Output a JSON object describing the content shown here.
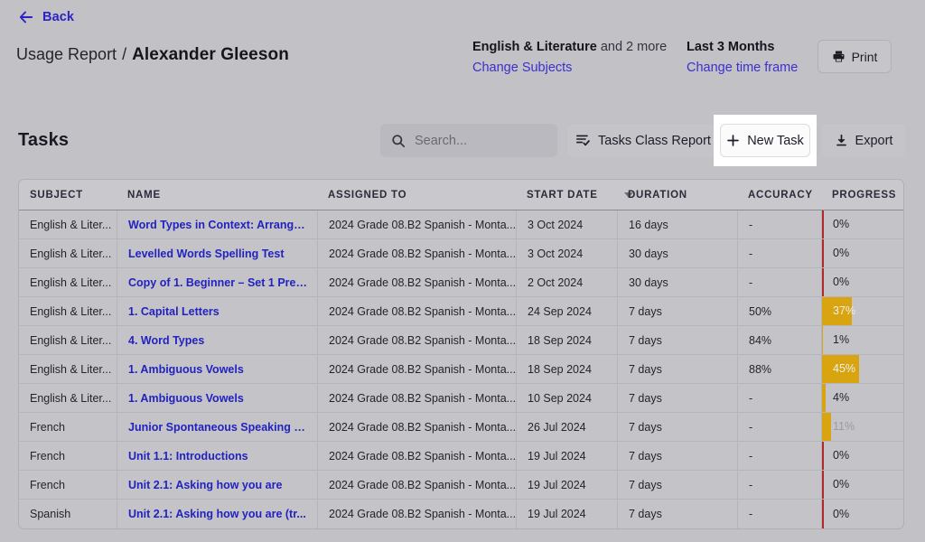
{
  "nav": {
    "back_label": "Back",
    "back_icon": "arrow-left-icon"
  },
  "breadcrumb": {
    "parent": "Usage Report",
    "separator": "/",
    "current": "Alexander Gleeson"
  },
  "header": {
    "subjects": {
      "primary": "English & Literature",
      "suffix": "and 2 more",
      "change_link": "Change Subjects"
    },
    "timeframe": {
      "value": "Last 3 Months",
      "change_link": "Change time frame"
    },
    "print": {
      "label": "Print",
      "icon": "printer-icon"
    }
  },
  "section": {
    "title": "Tasks"
  },
  "toolbar": {
    "search": {
      "placeholder": "Search...",
      "value": "",
      "icon": "search-icon"
    },
    "class_report": {
      "label": "Tasks Class Report",
      "icon": "list-check-icon"
    },
    "new_task": {
      "label": "New Task",
      "icon": "plus-icon"
    },
    "export": {
      "label": "Export",
      "icon": "download-icon"
    }
  },
  "table": {
    "columns": [
      {
        "key": "subject",
        "label": "SUBJECT"
      },
      {
        "key": "name",
        "label": "NAME"
      },
      {
        "key": "assigned",
        "label": "ASSIGNED TO"
      },
      {
        "key": "start",
        "label": "START DATE"
      },
      {
        "key": "duration",
        "label": "DURATION"
      },
      {
        "key": "accuracy",
        "label": "ACCURACY"
      },
      {
        "key": "progress",
        "label": "PROGRESS"
      }
    ],
    "sort": {
      "column": "START DATE",
      "direction": "desc",
      "icon": "caret-down-icon"
    },
    "rows": [
      {
        "subject": "English & Liter...",
        "name": "Word Types in Context: Arrange ...",
        "assigned": "2024 Grade 08.B2 Spanish - Monta...",
        "start": "3 Oct 2024",
        "duration": "16 days",
        "accuracy": "-",
        "progress_label": "0%",
        "progress_value": 0
      },
      {
        "subject": "English & Liter...",
        "name": "Levelled Words Spelling Test",
        "assigned": "2024 Grade 08.B2 Spanish - Monta...",
        "start": "3 Oct 2024",
        "duration": "30 days",
        "accuracy": "-",
        "progress_label": "0%",
        "progress_value": 0
      },
      {
        "subject": "English & Liter...",
        "name": "Copy of 1. Beginner – Set 1 Pre-t...",
        "assigned": "2024 Grade 08.B2 Spanish - Monta...",
        "start": "2 Oct 2024",
        "duration": "30 days",
        "accuracy": "-",
        "progress_label": "0%",
        "progress_value": 0
      },
      {
        "subject": "English & Liter...",
        "name": "1. Capital Letters",
        "assigned": "2024 Grade 08.B2 Spanish - Monta...",
        "start": "24 Sep 2024",
        "duration": "7 days",
        "accuracy": "50%",
        "progress_label": "37%",
        "progress_value": 37
      },
      {
        "subject": "English & Liter...",
        "name": "4. Word Types",
        "assigned": "2024 Grade 08.B2 Spanish - Monta...",
        "start": "18 Sep 2024",
        "duration": "7 days",
        "accuracy": "84%",
        "progress_label": "1%",
        "progress_value": 1
      },
      {
        "subject": "English & Liter...",
        "name": "1. Ambiguous Vowels",
        "assigned": "2024 Grade 08.B2 Spanish - Monta...",
        "start": "18 Sep 2024",
        "duration": "7 days",
        "accuracy": "88%",
        "progress_label": "45%",
        "progress_value": 45
      },
      {
        "subject": "English & Liter...",
        "name": "1. Ambiguous Vowels",
        "assigned": "2024 Grade 08.B2 Spanish - Monta...",
        "start": "10 Sep 2024",
        "duration": "7 days",
        "accuracy": "-",
        "progress_label": "4%",
        "progress_value": 4
      },
      {
        "subject": "French",
        "name": "Junior Spontaneous Speaking Q...",
        "assigned": "2024 Grade 08.B2 Spanish - Monta...",
        "start": "26 Jul 2024",
        "duration": "7 days",
        "accuracy": "-",
        "progress_label": "11%",
        "progress_value": 11
      },
      {
        "subject": "French",
        "name": "Unit 1.1: Introductions",
        "assigned": "2024 Grade 08.B2 Spanish - Monta...",
        "start": "19 Jul 2024",
        "duration": "7 days",
        "accuracy": "-",
        "progress_label": "0%",
        "progress_value": 0
      },
      {
        "subject": "French",
        "name": "Unit 2.1: Asking how you are",
        "assigned": "2024 Grade 08.B2 Spanish - Monta...",
        "start": "19 Jul 2024",
        "duration": "7 days",
        "accuracy": "-",
        "progress_label": "0%",
        "progress_value": 0
      },
      {
        "subject": "Spanish",
        "name": "Unit 2.1: Asking how you are (tr...",
        "assigned": "2024 Grade 08.B2 Spanish - Monta...",
        "start": "19 Jul 2024",
        "duration": "7 days",
        "accuracy": "-",
        "progress_label": "0%",
        "progress_value": 0
      }
    ]
  },
  "colors": {
    "link": "#2222c0",
    "nav_link": "#2b23c4",
    "progress_bar": "#d8a410",
    "progress_zero": "#b02828",
    "page_bg": "#c2c2c6"
  }
}
